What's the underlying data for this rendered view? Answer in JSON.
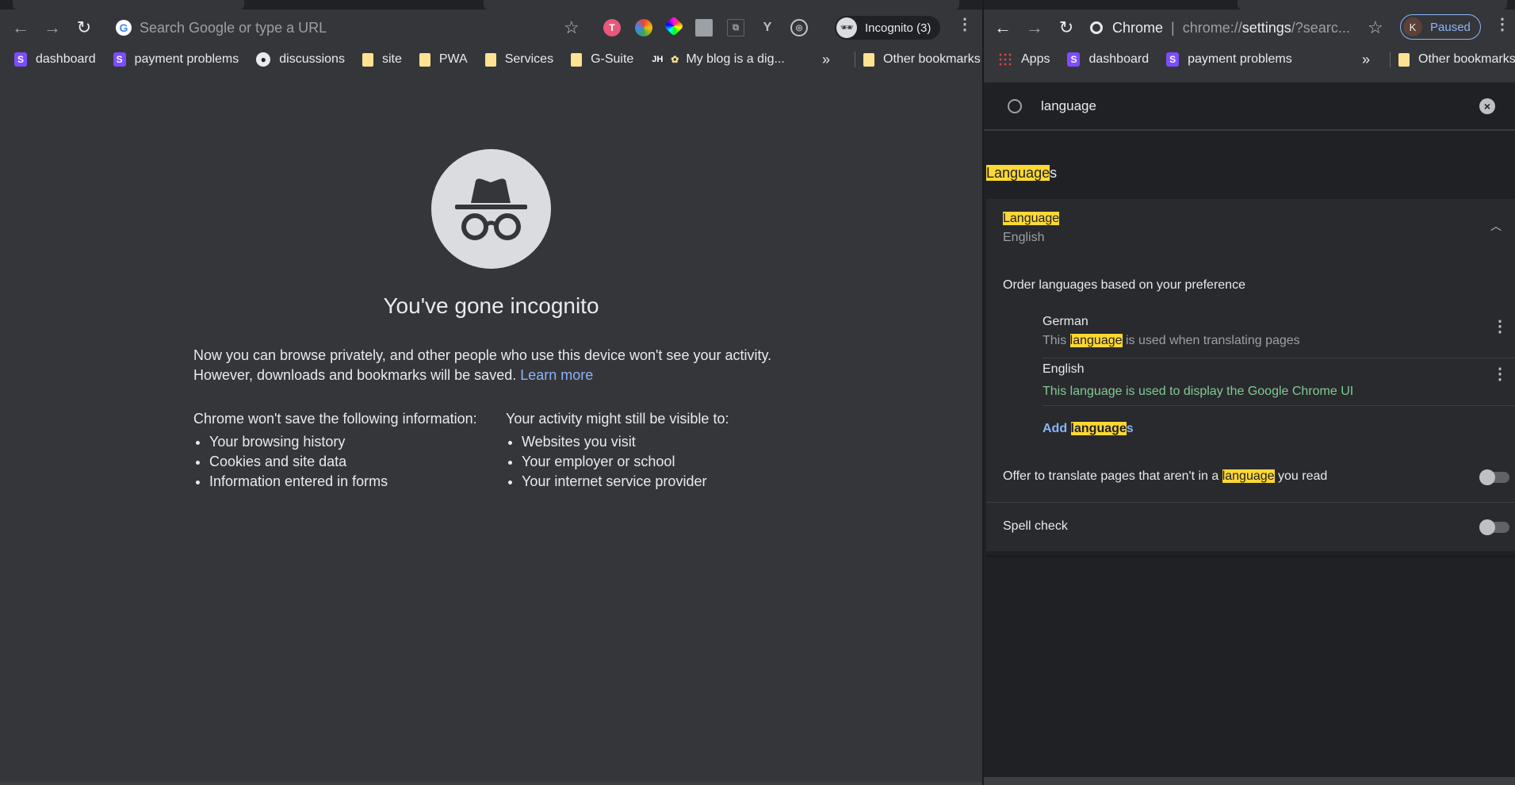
{
  "left": {
    "omnibox_placeholder": "Search Google or type a URL",
    "profile_label": "Incognito (3)",
    "bookmarks": [
      {
        "label": "dashboard",
        "icon": "stackbit-icon"
      },
      {
        "label": "payment problems",
        "icon": "stackbit-icon"
      },
      {
        "label": "discussions",
        "icon": "github-icon"
      },
      {
        "label": "site",
        "icon": "folder-icon"
      },
      {
        "label": "PWA",
        "icon": "folder-icon"
      },
      {
        "label": "Services",
        "icon": "folder-icon"
      },
      {
        "label": "G-Suite",
        "icon": "folder-icon"
      },
      {
        "label": "My blog is a dig...",
        "icon": "sprout-icon"
      }
    ],
    "bookmarks_overflow": "»",
    "other_bookmarks": "Other bookmarks",
    "incognito": {
      "title": "You've gone incognito",
      "para_line1": "Now you can browse privately, and other people who use this device won't see your activity.",
      "para_line2": "However, downloads and bookmarks will be saved.",
      "learn_more": "Learn more",
      "col1_heading": "Chrome won't save the following information:",
      "col1_items": [
        "Your browsing history",
        "Cookies and site data",
        "Information entered in forms"
      ],
      "col2_heading": "Your activity might still be visible to:",
      "col2_items": [
        "Websites you visit",
        "Your employer or school",
        "Your internet service provider"
      ]
    }
  },
  "right": {
    "omni_site": "Chrome",
    "omni_sep": "|",
    "omni_url_prefix": "chrome://",
    "omni_url_bold": "settings",
    "omni_url_rest": "/?searc...",
    "profile_initial": "K",
    "profile_status": "Paused",
    "bookmarks": [
      {
        "label": "Apps",
        "icon": "apps-grid-icon"
      },
      {
        "label": "dashboard",
        "icon": "stackbit-icon"
      },
      {
        "label": "payment problems",
        "icon": "stackbit-icon"
      }
    ],
    "bookmarks_overflow": "»",
    "other_bookmarks": "Other bookmarks",
    "search_value": "language",
    "section_title_hl": "Language",
    "section_title_rest": "s",
    "language_label": "Language",
    "language_value": "English",
    "order_label": "Order languages based on your preference",
    "languages": [
      {
        "name": "German",
        "desc_pre": "This ",
        "desc_hl": "language",
        "desc_post": " is used when translating pages"
      },
      {
        "name": "English",
        "desc_full": "This language is used to display the Google Chrome UI"
      }
    ],
    "add_pre": "Add ",
    "add_hl": "language",
    "add_post": "s",
    "offer_pre": "Offer to translate pages that aren't in a ",
    "offer_hl": "language",
    "offer_post": " you read",
    "spell_check": "Spell check"
  },
  "colors": {
    "accent": "#8ab4f8",
    "highlight": "#fdd835",
    "ui_green": "#81c995",
    "bg": "#35363a"
  }
}
